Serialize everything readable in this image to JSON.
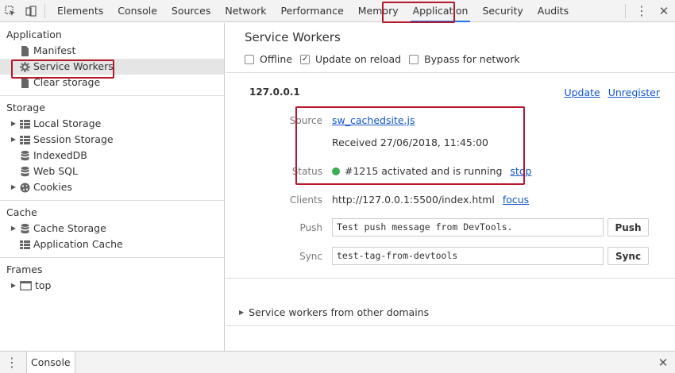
{
  "toolbar": {
    "tabs": [
      {
        "label": "Elements"
      },
      {
        "label": "Console"
      },
      {
        "label": "Sources"
      },
      {
        "label": "Network"
      },
      {
        "label": "Performance"
      },
      {
        "label": "Memory"
      },
      {
        "label": "Application",
        "active": true
      },
      {
        "label": "Security"
      },
      {
        "label": "Audits"
      }
    ]
  },
  "sidebar": {
    "application": {
      "title": "Application",
      "items": [
        {
          "label": "Manifest",
          "icon": "file-icon"
        },
        {
          "label": "Service Workers",
          "icon": "gear-icon",
          "selected": true
        },
        {
          "label": "Clear storage",
          "icon": "file-icon"
        }
      ]
    },
    "storage": {
      "title": "Storage",
      "items": [
        {
          "label": "Local Storage",
          "icon": "grid-icon",
          "expandable": true
        },
        {
          "label": "Session Storage",
          "icon": "grid-icon",
          "expandable": true
        },
        {
          "label": "IndexedDB",
          "icon": "database-icon",
          "expandable": false
        },
        {
          "label": "Web SQL",
          "icon": "database-icon",
          "expandable": false
        },
        {
          "label": "Cookies",
          "icon": "cookie-icon",
          "expandable": true
        }
      ]
    },
    "cache": {
      "title": "Cache",
      "items": [
        {
          "label": "Cache Storage",
          "icon": "database-icon",
          "expandable": true
        },
        {
          "label": "Application Cache",
          "icon": "grid-icon",
          "expandable": false
        }
      ]
    },
    "frames": {
      "title": "Frames",
      "items": [
        {
          "label": "top",
          "icon": "frame-icon",
          "expandable": true
        }
      ]
    }
  },
  "main": {
    "title": "Service Workers",
    "options": {
      "offline": {
        "label": "Offline",
        "checked": false
      },
      "update_on_reload": {
        "label": "Update on reload",
        "checked": true
      },
      "bypass": {
        "label": "Bypass for network",
        "checked": false
      }
    },
    "worker": {
      "host": "127.0.0.1",
      "update_label": "Update",
      "unregister_label": "Unregister",
      "source_label": "Source",
      "source_file": "sw_cachedsite.js",
      "received": "Received 27/06/2018, 11:45:00",
      "status_label": "Status",
      "status_text": "#1215 activated and is running",
      "status_color": "#3bae4f",
      "stop_label": "stop",
      "clients_label": "Clients",
      "clients_url": "http://127.0.0.1:5500/index.html",
      "focus_label": "focus",
      "push_label": "Push",
      "push_value": "Test push message from DevTools.",
      "push_button": "Push",
      "sync_label": "Sync",
      "sync_value": "test-tag-from-devtools",
      "sync_button": "Sync"
    },
    "other_domains": "Service workers from other domains"
  },
  "drawer": {
    "tab": "Console"
  },
  "colors": {
    "highlight": "#b5172c",
    "link": "#1155cc",
    "active_tab": "#1a73e8"
  }
}
